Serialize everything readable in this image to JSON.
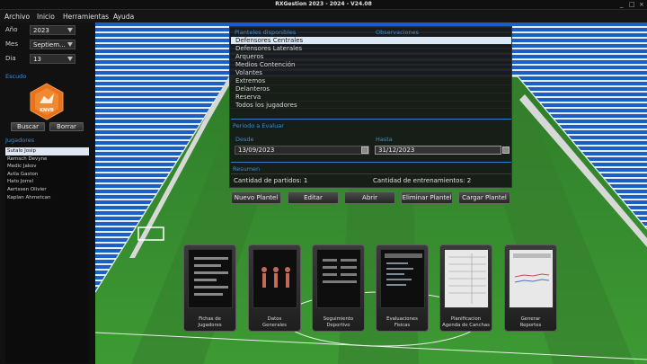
{
  "window": {
    "title": "RXGestion 2023 - 2024 - V24.08",
    "minimize": "_",
    "maximize": "□",
    "close": "×"
  },
  "menu": [
    "Archivo",
    "Inicio",
    "Herramientas",
    "Ayuda"
  ],
  "filters": {
    "year_label": "Año",
    "year_value": "2023",
    "month_label": "Mes",
    "month_value": "Septiem...",
    "day_label": "Dia",
    "day_value": "13"
  },
  "shield": {
    "label": "Escudo",
    "club_text": "KNVB",
    "buscar": "Buscar",
    "borrar": "Borrar"
  },
  "players": {
    "label": "Jugadores",
    "items": [
      "Sutalo Josip",
      "Remsch Devyne",
      "Medic Jakov",
      "Avila Gaston",
      "Hato Jorrel",
      "Aertssen Olivier",
      "Kaplan Ahmetcan"
    ]
  },
  "dialog": {
    "col_planteles": "Planteles disponibles",
    "col_observaciones": "Observaciones",
    "planteles": [
      "Defensores Centrales",
      "Defensores Laterales",
      "Arqueros",
      "Medios Contención",
      "Volantes",
      "Extremos",
      "Delanteros",
      "Reserva",
      "Todos los jugadores"
    ],
    "periodo_label": "Periodo a Evaluar",
    "desde_label": "Desde",
    "desde_value": "13/09/2023",
    "hasta_label": "Hasta",
    "hasta_value": "31/12/2023",
    "resumen_label": "Resumen",
    "partidos": "Cantidad de partidos: 1",
    "entrenamientos": "Cantidad de entrenamientos: 2"
  },
  "actions": [
    "Nuevo Plantel",
    "Editar",
    "Abrir",
    "Eliminar Plantel",
    "Cargar Plantel"
  ],
  "modules": [
    {
      "line1": "Fichas de",
      "line2": "Jugadores"
    },
    {
      "line1": "Datos",
      "line2": "Generales"
    },
    {
      "line1": "Seguimiento",
      "line2": "Deportivo"
    },
    {
      "line1": "Evaluaciones",
      "line2": "Fisicas"
    },
    {
      "line1": "Planificacion",
      "line2": "Agenda de Canchas"
    },
    {
      "line1": "Generar",
      "line2": "Reportes"
    }
  ],
  "colors": {
    "accent": "#3b8fd6",
    "shield_orange": "#e8721c",
    "pitch": "#3f8f36"
  }
}
